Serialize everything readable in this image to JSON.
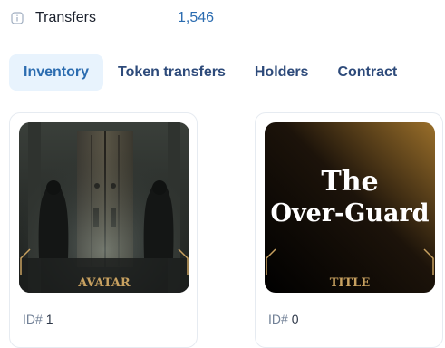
{
  "stats": {
    "transfers_label": "Transfers",
    "transfers_value": "1,546"
  },
  "tabs": [
    {
      "label": "Inventory",
      "active": true
    },
    {
      "label": "Token transfers",
      "active": false
    },
    {
      "label": "Holders",
      "active": false
    },
    {
      "label": "Contract",
      "active": false
    }
  ],
  "tokens": [
    {
      "image_caption": "AVATAR",
      "id_prefix": "ID#",
      "id_value": "1"
    },
    {
      "image_title_line1": "The",
      "image_title_line2": "Over-Guard",
      "image_caption": "TITLE",
      "id_prefix": "ID#",
      "id_value": "0"
    }
  ],
  "colors": {
    "accent": "#2b6cb0",
    "tab_active_bg": "#e8f3fd",
    "gold": "#c8a160"
  },
  "icons": {
    "info": "info-icon"
  }
}
